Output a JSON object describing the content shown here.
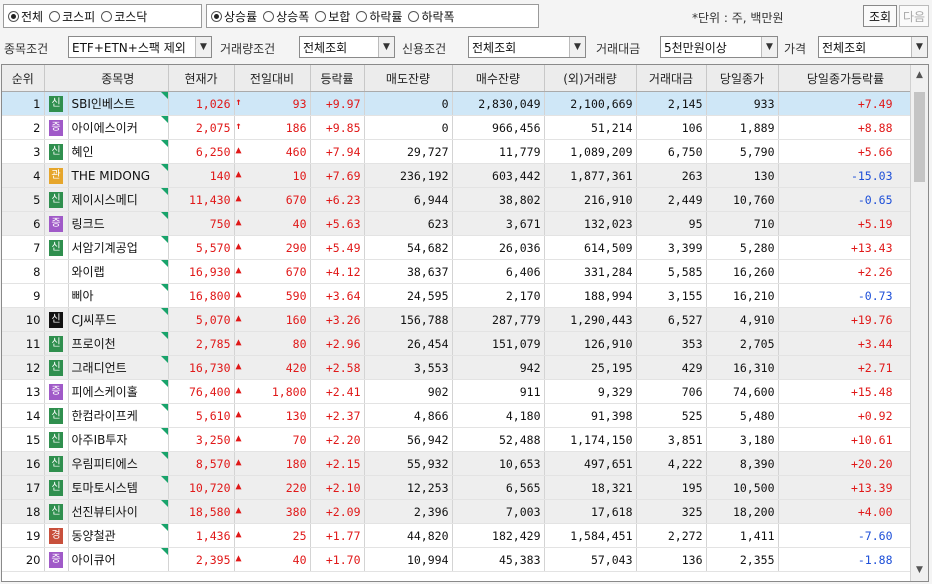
{
  "market_filter": {
    "options": [
      "전체",
      "코스피",
      "코스닥"
    ],
    "selected": 0
  },
  "sort_filter": {
    "options": [
      "상승률",
      "상승폭",
      "보합",
      "하락률",
      "하락폭"
    ],
    "selected": 0
  },
  "unit_label": "*단위 : 주, 백만원",
  "buttons": {
    "search": "조회",
    "next": "다음"
  },
  "filters": {
    "stock_condition_label": "종목조건",
    "stock_condition_value": "ETF+ETN+스팩 제외",
    "volume_condition_label": "거래량조건",
    "volume_condition_value": "전체조회",
    "credit_condition_label": "신용조건",
    "credit_condition_value": "전체조회",
    "trade_amount_label": "거래대금",
    "trade_amount_value": "5천만원이상",
    "price_label": "가격",
    "price_value": "전체조회"
  },
  "columns": [
    "순위",
    "종목명",
    "현재가",
    "전일대비",
    "등락률",
    "매도잔량",
    "매수잔량",
    "(외)거래량",
    "거래대금",
    "당일종가",
    "당일종가등락률"
  ],
  "rows": [
    {
      "rank": "1",
      "tag": "신",
      "name": "SBI인베스트",
      "price": "1,026",
      "arrow": "upper",
      "diff": "93",
      "rate": "+9.97",
      "ask": "0",
      "bid": "2,830,049",
      "vol": "2,100,669",
      "amt": "2,145",
      "close": "933",
      "crate": "+7.49",
      "cdir": "up"
    },
    {
      "rank": "2",
      "tag": "증",
      "name": "아이에스이커",
      "price": "2,075",
      "arrow": "upper",
      "diff": "186",
      "rate": "+9.85",
      "ask": "0",
      "bid": "966,456",
      "vol": "51,214",
      "amt": "106",
      "close": "1,889",
      "crate": "+8.88",
      "cdir": "up"
    },
    {
      "rank": "3",
      "tag": "신",
      "name": "혜인",
      "price": "6,250",
      "arrow": "up",
      "diff": "460",
      "rate": "+7.94",
      "ask": "29,727",
      "bid": "11,779",
      "vol": "1,089,209",
      "amt": "6,750",
      "close": "5,790",
      "crate": "+5.66",
      "cdir": "up"
    },
    {
      "rank": "4",
      "tag": "관",
      "name": "THE MIDONG",
      "price": "140",
      "arrow": "up",
      "diff": "10",
      "rate": "+7.69",
      "ask": "236,192",
      "bid": "603,442",
      "vol": "1,877,361",
      "amt": "263",
      "close": "130",
      "crate": "-15.03",
      "cdir": "dn"
    },
    {
      "rank": "5",
      "tag": "신",
      "name": "제이시스메디",
      "price": "11,430",
      "arrow": "up",
      "diff": "670",
      "rate": "+6.23",
      "ask": "6,944",
      "bid": "38,802",
      "vol": "216,910",
      "amt": "2,449",
      "close": "10,760",
      "crate": "-0.65",
      "cdir": "dn"
    },
    {
      "rank": "6",
      "tag": "증",
      "name": "링크드",
      "price": "750",
      "arrow": "up",
      "diff": "40",
      "rate": "+5.63",
      "ask": "623",
      "bid": "3,671",
      "vol": "132,023",
      "amt": "95",
      "close": "710",
      "crate": "+5.19",
      "cdir": "up"
    },
    {
      "rank": "7",
      "tag": "신",
      "name": "서암기계공업",
      "price": "5,570",
      "arrow": "up",
      "diff": "290",
      "rate": "+5.49",
      "ask": "54,682",
      "bid": "26,036",
      "vol": "614,509",
      "amt": "3,399",
      "close": "5,280",
      "crate": "+13.43",
      "cdir": "up"
    },
    {
      "rank": "8",
      "tag": "",
      "name": "와이랩",
      "price": "16,930",
      "arrow": "up",
      "diff": "670",
      "rate": "+4.12",
      "ask": "38,637",
      "bid": "6,406",
      "vol": "331,284",
      "amt": "5,585",
      "close": "16,260",
      "crate": "+2.26",
      "cdir": "up"
    },
    {
      "rank": "9",
      "tag": "",
      "name": "삐아",
      "price": "16,800",
      "arrow": "up",
      "diff": "590",
      "rate": "+3.64",
      "ask": "24,595",
      "bid": "2,170",
      "vol": "188,994",
      "amt": "3,155",
      "close": "16,210",
      "crate": "-0.73",
      "cdir": "dn"
    },
    {
      "rank": "10",
      "tag": "신k",
      "name": "CJ씨푸드",
      "price": "5,070",
      "arrow": "up",
      "diff": "160",
      "rate": "+3.26",
      "ask": "156,788",
      "bid": "287,779",
      "vol": "1,290,443",
      "amt": "6,527",
      "close": "4,910",
      "crate": "+19.76",
      "cdir": "up"
    },
    {
      "rank": "11",
      "tag": "신",
      "name": "프로이천",
      "price": "2,785",
      "arrow": "up",
      "diff": "80",
      "rate": "+2.96",
      "ask": "26,454",
      "bid": "151,079",
      "vol": "126,910",
      "amt": "353",
      "close": "2,705",
      "crate": "+3.44",
      "cdir": "up"
    },
    {
      "rank": "12",
      "tag": "신",
      "name": "그래디언트",
      "price": "16,730",
      "arrow": "up",
      "diff": "420",
      "rate": "+2.58",
      "ask": "3,553",
      "bid": "942",
      "vol": "25,195",
      "amt": "429",
      "close": "16,310",
      "crate": "+2.71",
      "cdir": "up"
    },
    {
      "rank": "13",
      "tag": "증",
      "name": "피에스케이홀",
      "price": "76,400",
      "arrow": "up",
      "diff": "1,800",
      "rate": "+2.41",
      "ask": "902",
      "bid": "911",
      "vol": "9,329",
      "amt": "706",
      "close": "74,600",
      "crate": "+15.48",
      "cdir": "up"
    },
    {
      "rank": "14",
      "tag": "신",
      "name": "한컴라이프케",
      "price": "5,610",
      "arrow": "up",
      "diff": "130",
      "rate": "+2.37",
      "ask": "4,866",
      "bid": "4,180",
      "vol": "91,398",
      "amt": "525",
      "close": "5,480",
      "crate": "+0.92",
      "cdir": "up"
    },
    {
      "rank": "15",
      "tag": "신",
      "name": "아주IB투자",
      "price": "3,250",
      "arrow": "up",
      "diff": "70",
      "rate": "+2.20",
      "ask": "56,942",
      "bid": "52,488",
      "vol": "1,174,150",
      "amt": "3,851",
      "close": "3,180",
      "crate": "+10.61",
      "cdir": "up"
    },
    {
      "rank": "16",
      "tag": "신",
      "name": "우림피티에스",
      "price": "8,570",
      "arrow": "up",
      "diff": "180",
      "rate": "+2.15",
      "ask": "55,932",
      "bid": "10,653",
      "vol": "497,651",
      "amt": "4,222",
      "close": "8,390",
      "crate": "+20.20",
      "cdir": "up"
    },
    {
      "rank": "17",
      "tag": "신",
      "name": "토마토시스템",
      "price": "10,720",
      "arrow": "up",
      "diff": "220",
      "rate": "+2.10",
      "ask": "12,253",
      "bid": "6,565",
      "vol": "18,321",
      "amt": "195",
      "close": "10,500",
      "crate": "+13.39",
      "cdir": "up"
    },
    {
      "rank": "18",
      "tag": "신",
      "name": "선진뷰티사이",
      "price": "18,580",
      "arrow": "up",
      "diff": "380",
      "rate": "+2.09",
      "ask": "2,396",
      "bid": "7,003",
      "vol": "17,618",
      "amt": "325",
      "close": "18,200",
      "crate": "+4.00",
      "cdir": "up"
    },
    {
      "rank": "19",
      "tag": "경",
      "name": "동양철관",
      "price": "1,436",
      "arrow": "up",
      "diff": "25",
      "rate": "+1.77",
      "ask": "44,820",
      "bid": "182,429",
      "vol": "1,584,451",
      "amt": "2,272",
      "close": "1,411",
      "crate": "-7.60",
      "cdir": "dn"
    },
    {
      "rank": "20",
      "tag": "증",
      "name": "아이큐어",
      "price": "2,395",
      "arrow": "up",
      "diff": "40",
      "rate": "+1.70",
      "ask": "10,994",
      "bid": "45,383",
      "vol": "57,043",
      "amt": "136",
      "close": "2,355",
      "crate": "-1.88",
      "cdir": "dn"
    }
  ]
}
